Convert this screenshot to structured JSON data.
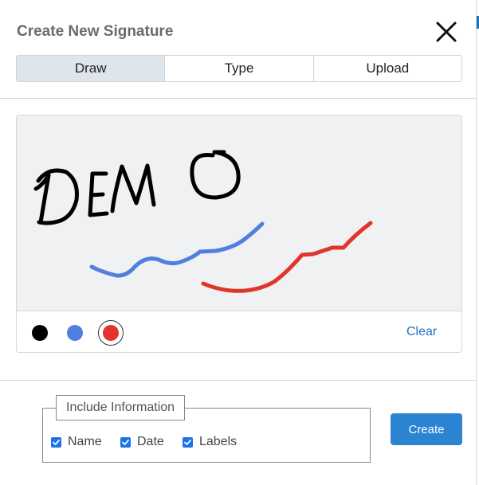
{
  "dialog": {
    "title": "Create New Signature"
  },
  "tabs": [
    {
      "label": "Draw",
      "active": true
    },
    {
      "label": "Type",
      "active": false
    },
    {
      "label": "Upload",
      "active": false
    }
  ],
  "canvas": {
    "strokes": [
      {
        "color": "#000000",
        "description_text": "DEMO"
      },
      {
        "color": "#4f7fe3"
      },
      {
        "color": "#e0352b"
      }
    ],
    "colors": [
      {
        "name": "black",
        "hex": "#000000",
        "selected": false
      },
      {
        "name": "blue",
        "hex": "#4f7fe3",
        "selected": false
      },
      {
        "name": "red",
        "hex": "#e0352b",
        "selected": true
      }
    ],
    "clear_label": "Clear"
  },
  "include_info": {
    "legend": "Include Information",
    "options": [
      {
        "label": "Name",
        "checked": true
      },
      {
        "label": "Date",
        "checked": true
      },
      {
        "label": "Labels",
        "checked": true
      }
    ]
  },
  "actions": {
    "create_label": "Create"
  }
}
